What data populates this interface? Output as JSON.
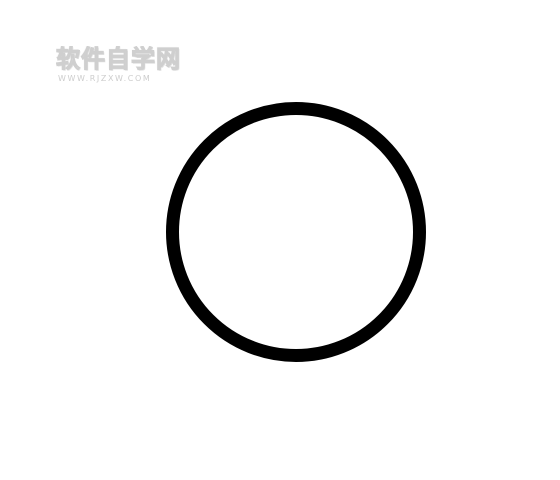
{
  "watermark": {
    "title": "软件自学网",
    "url": "WWW.RJZXW.COM"
  },
  "figure": {
    "shape": "circle-outline",
    "stroke_color": "#000000",
    "fill_color": "#ffffff"
  }
}
